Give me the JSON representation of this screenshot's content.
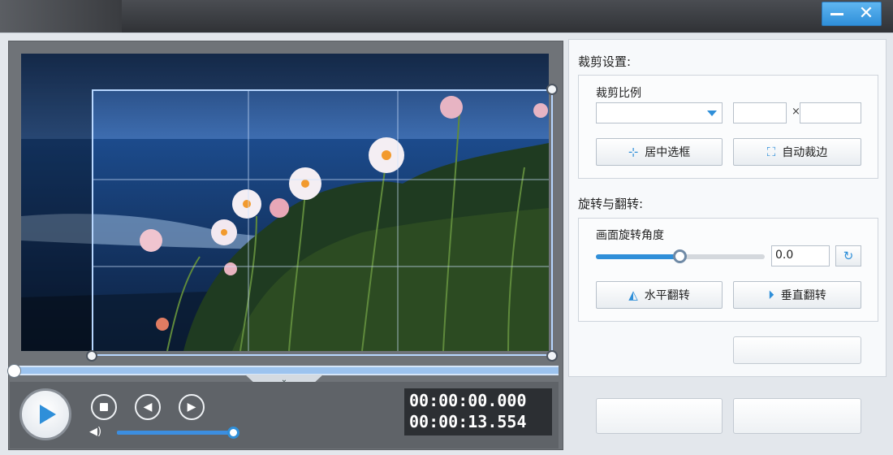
{
  "window": {
    "minimize_icon": "minimize-icon",
    "close_icon": "close-icon",
    "close_glyph": "✕"
  },
  "player": {
    "current_time": "00:00:00.000",
    "total_time": "00:00:13.554",
    "progress": 0.0,
    "volume": 0.95,
    "expand_glyph": "⌄"
  },
  "crop": {
    "section_title": "裁剪设置:",
    "ratio_label": "裁剪比例",
    "times_sign": "×",
    "center_button": "居中选框",
    "auto_trim_button": "自动裁边"
  },
  "rotate": {
    "section_title": "旋转与翻转:",
    "angle_label": "画面旋转角度",
    "angle_value": "0.0",
    "angle_slider_fraction": 0.5,
    "flip_h_button": "水平翻转",
    "flip_v_button": "垂直翻转"
  },
  "accent_color": "#2f8fd9"
}
